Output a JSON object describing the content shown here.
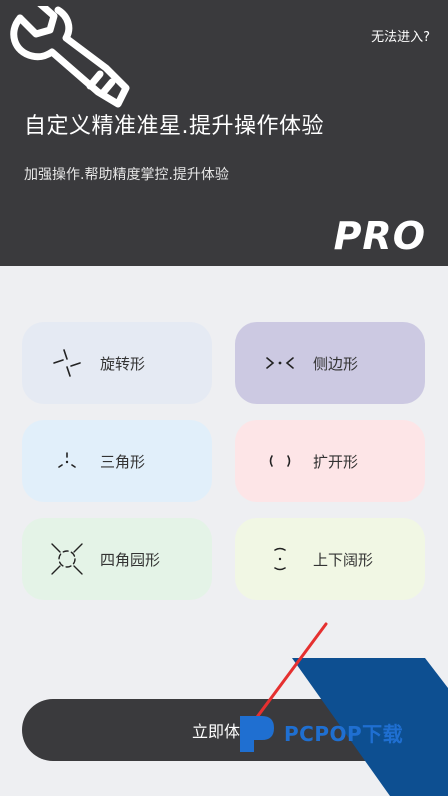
{
  "header": {
    "link": "无法进入?",
    "title": "自定义精准准星.提升操作体验",
    "subtitle": "加强操作.帮助精度掌控.提升体验",
    "badge": "PRO"
  },
  "styles": [
    {
      "label": "旋转形",
      "icon": "rotate-crosshair-icon",
      "color": "#e5eaf3"
    },
    {
      "label": "侧边形",
      "icon": "side-crosshair-icon",
      "color": "#ccc9e2"
    },
    {
      "label": "三角形",
      "icon": "triangle-crosshair-icon",
      "color": "#e1effa"
    },
    {
      "label": "扩开形",
      "icon": "expand-crosshair-icon",
      "color": "#fde5e7"
    },
    {
      "label": "四角园形",
      "icon": "four-corner-circle-crosshair-icon",
      "color": "#e4f3e7"
    },
    {
      "label": "上下阔形",
      "icon": "vertical-wide-crosshair-icon",
      "color": "#f1f7e4"
    }
  ],
  "action": {
    "label": "立即体验"
  },
  "watermark": {
    "text": "PCPOP下载"
  },
  "colors": {
    "header_bg": "#3a3a3d",
    "page_bg": "#eeeff2",
    "watermark_blue": "#0d4f91",
    "arrow_red": "#e53030"
  }
}
